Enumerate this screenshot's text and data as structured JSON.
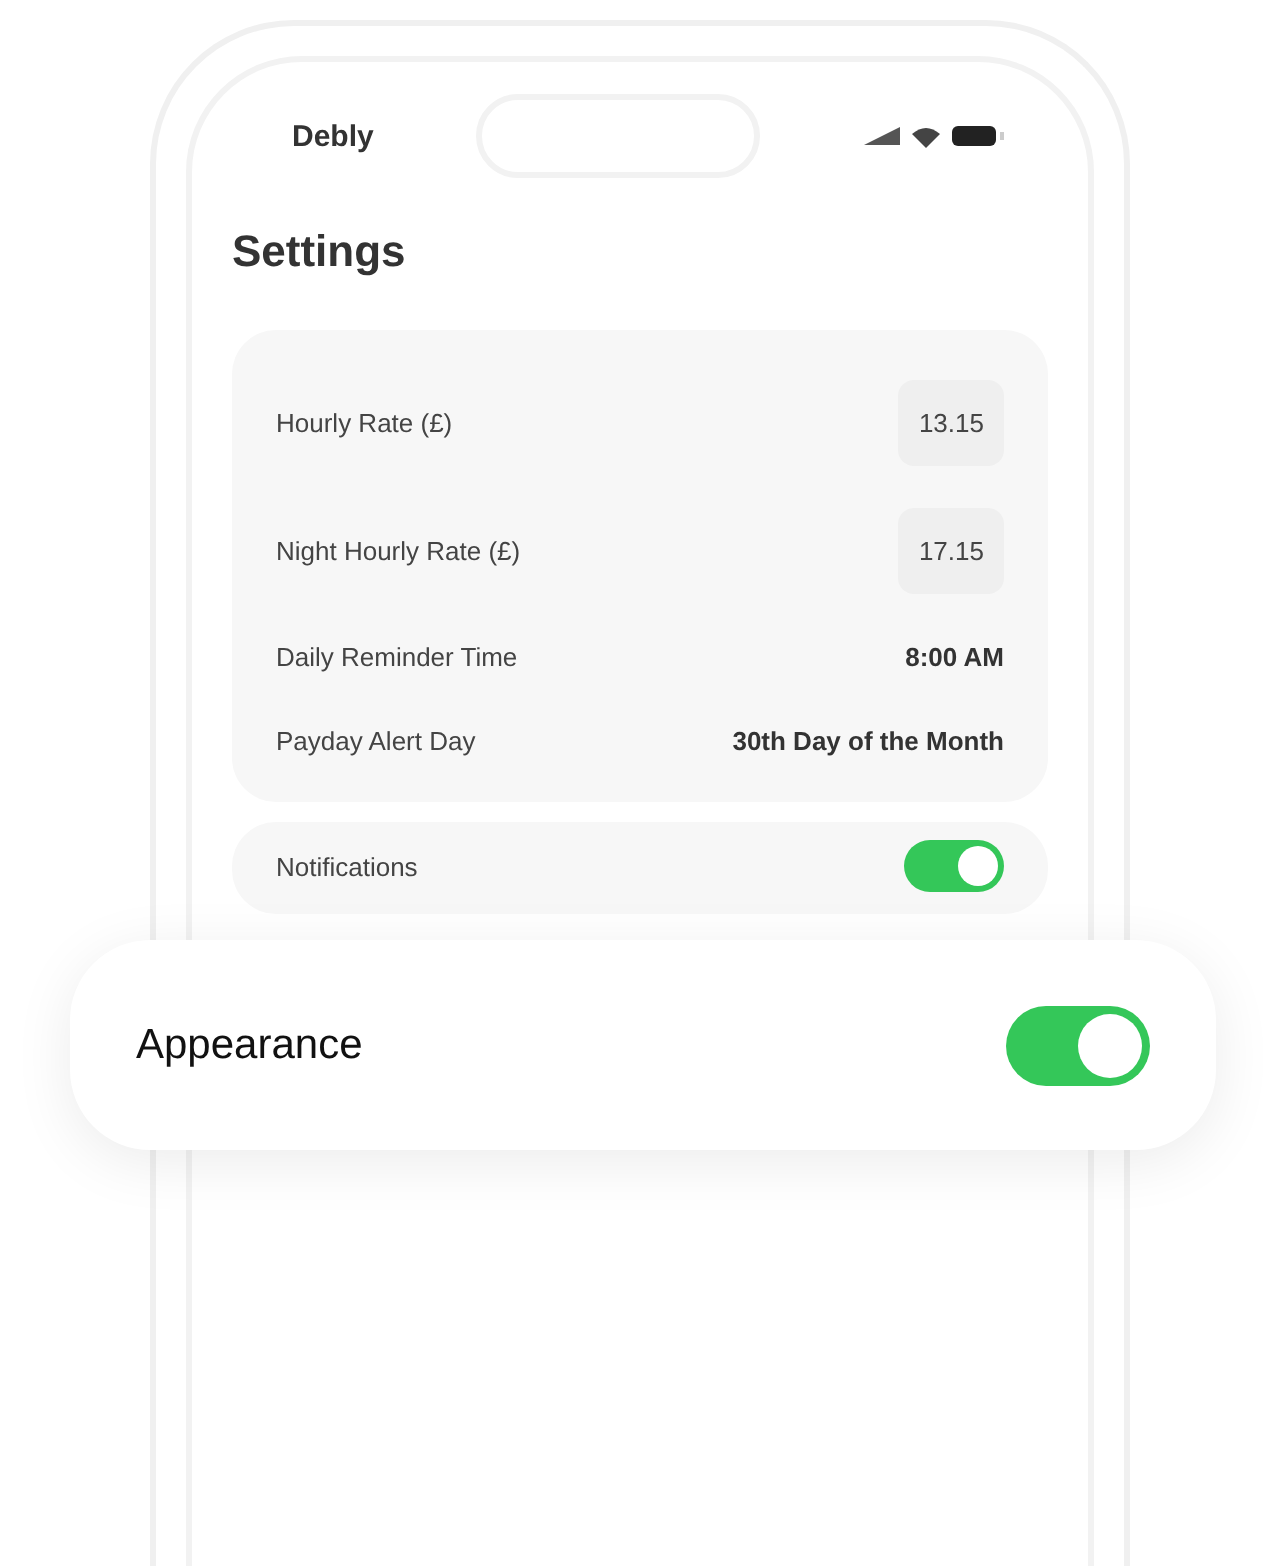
{
  "status_bar": {
    "carrier": "Debly"
  },
  "title": "Settings",
  "rates": [
    {
      "label": "Hourly Rate (£)",
      "value": "13.15",
      "kind": "input"
    },
    {
      "label": "Night Hourly Rate (£)",
      "value": "17.15",
      "kind": "input"
    },
    {
      "label": "Daily Reminder Time",
      "value": "8:00 AM",
      "kind": "text"
    },
    {
      "label": "Payday Alert Day",
      "value": "30th Day of the Month",
      "kind": "text"
    }
  ],
  "notifications": {
    "label": "Notifications",
    "on": true
  },
  "overlay": {
    "label": "Appearance",
    "on": true
  }
}
